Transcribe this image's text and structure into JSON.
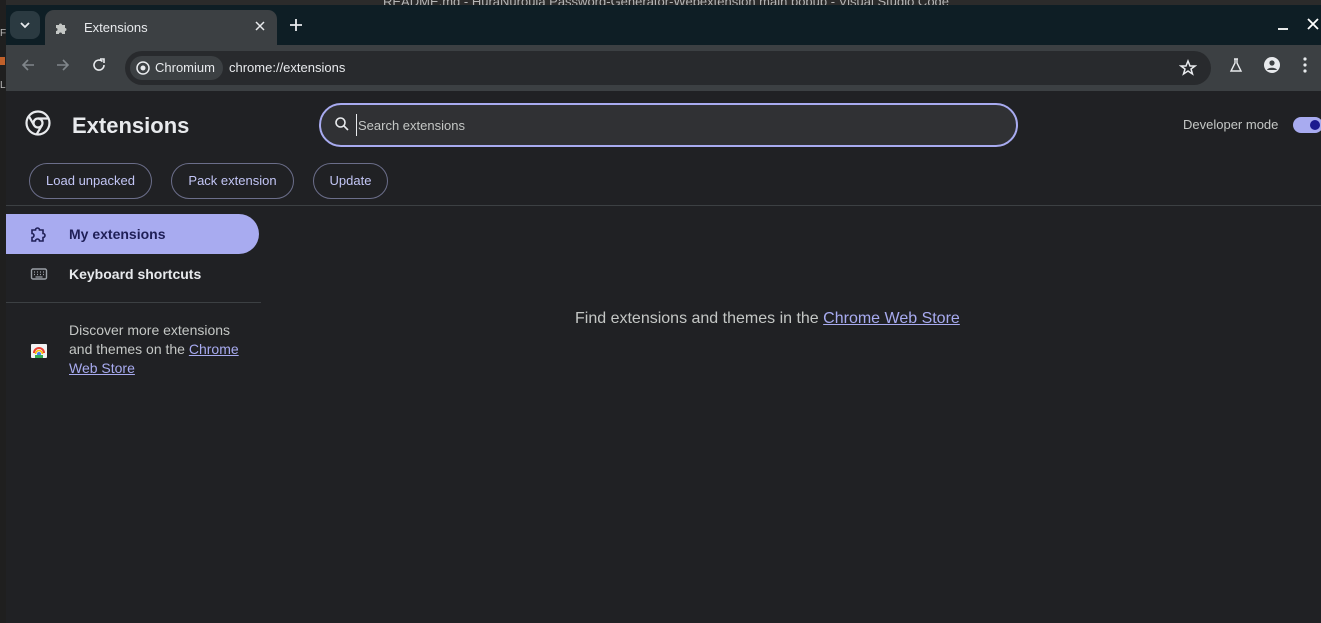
{
  "background": {
    "title": "README.md - HuraNuroula Password-Generator-Webextension main popup - Visual Studio Code"
  },
  "browser": {
    "tab": {
      "title": "Extensions",
      "icon": "puzzle-icon"
    },
    "toolbar": {
      "chip_label": "Chromium",
      "url": "chrome://extensions"
    }
  },
  "page": {
    "title": "Extensions",
    "search_placeholder": "Search extensions",
    "developer_mode_label": "Developer mode",
    "developer_mode_on": true,
    "buttons": {
      "load_unpacked": "Load unpacked",
      "pack_extension": "Pack extension",
      "update": "Update"
    },
    "sidebar": {
      "items": [
        {
          "label": "My extensions",
          "icon": "extension-icon",
          "active": true
        },
        {
          "label": "Keyboard shortcuts",
          "icon": "keyboard-icon",
          "active": false
        }
      ],
      "discover_prefix": "Discover more extensions and themes on the ",
      "discover_link": "Chrome Web Store"
    },
    "empty_prefix": "Find extensions and themes in the ",
    "empty_link": "Chrome Web Store"
  },
  "colors": {
    "accent": "#a8abf0",
    "background": "#202124",
    "toolbar": "#3c4043",
    "tabstrip": "#0e1e25"
  }
}
